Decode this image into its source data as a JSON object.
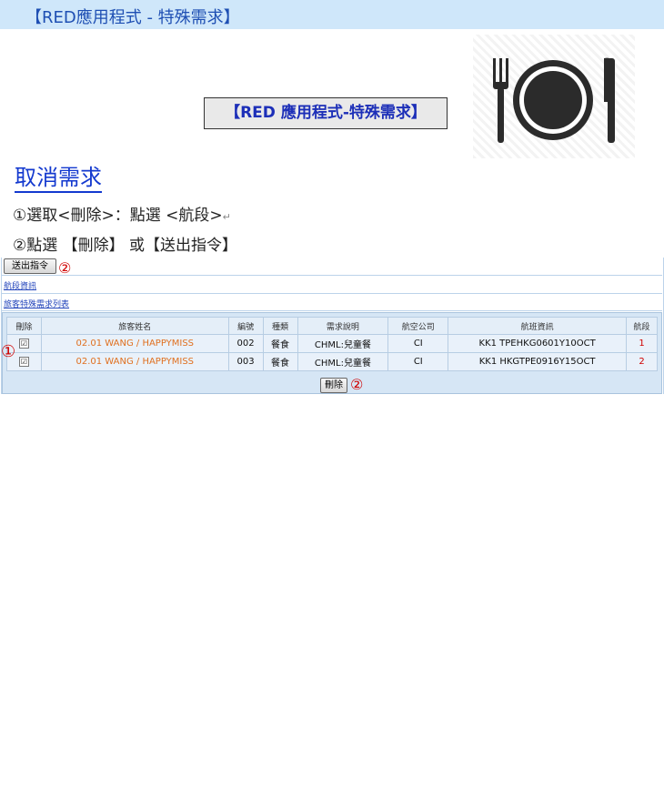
{
  "header": {
    "title": "【RED應用程式 - 特殊需求】"
  },
  "banner": {
    "text": "【RED 應用程式-特殊需求】"
  },
  "icon": {
    "name": "fork-plate-knife-icon"
  },
  "instructions": {
    "heading": "取消需求",
    "step1": "①選取<刪除>：點選  <航段>",
    "step1_mark": "↵",
    "step2": "②點選 【刪除】 或【送出指令】"
  },
  "app": {
    "send_button": "送出指令",
    "circle_two": "②",
    "circle_one": "①",
    "segment_info_link": "航段資訊",
    "special_request_list_link": "旅客特殊需求列表",
    "columns": [
      "刪除",
      "旅客姓名",
      "編號",
      "種類",
      "需求說明",
      "航空公司",
      "航班資訊",
      "航段"
    ],
    "rows": [
      {
        "checked": "☑",
        "name": "02.01 WANG / HAPPYMISS",
        "no": "002",
        "type": "餐食",
        "desc": "CHML:兒童餐",
        "airline": "CI",
        "flight": "KK1 TPEHKG0601Y10OCT",
        "segment": "1"
      },
      {
        "checked": "☑",
        "name": "02.01 WANG / HAPPYMISS",
        "no": "003",
        "type": "餐食",
        "desc": "CHML:兒童餐",
        "airline": "CI",
        "flight": "KK1 HKGTPE0916Y15OCT",
        "segment": "2"
      }
    ],
    "delete_button": "刪除"
  },
  "colors": {
    "accent_blue": "#1339cf",
    "header_bg": "#cfe7fa",
    "name_orange": "#e07020",
    "annotation_red": "#d00000"
  }
}
